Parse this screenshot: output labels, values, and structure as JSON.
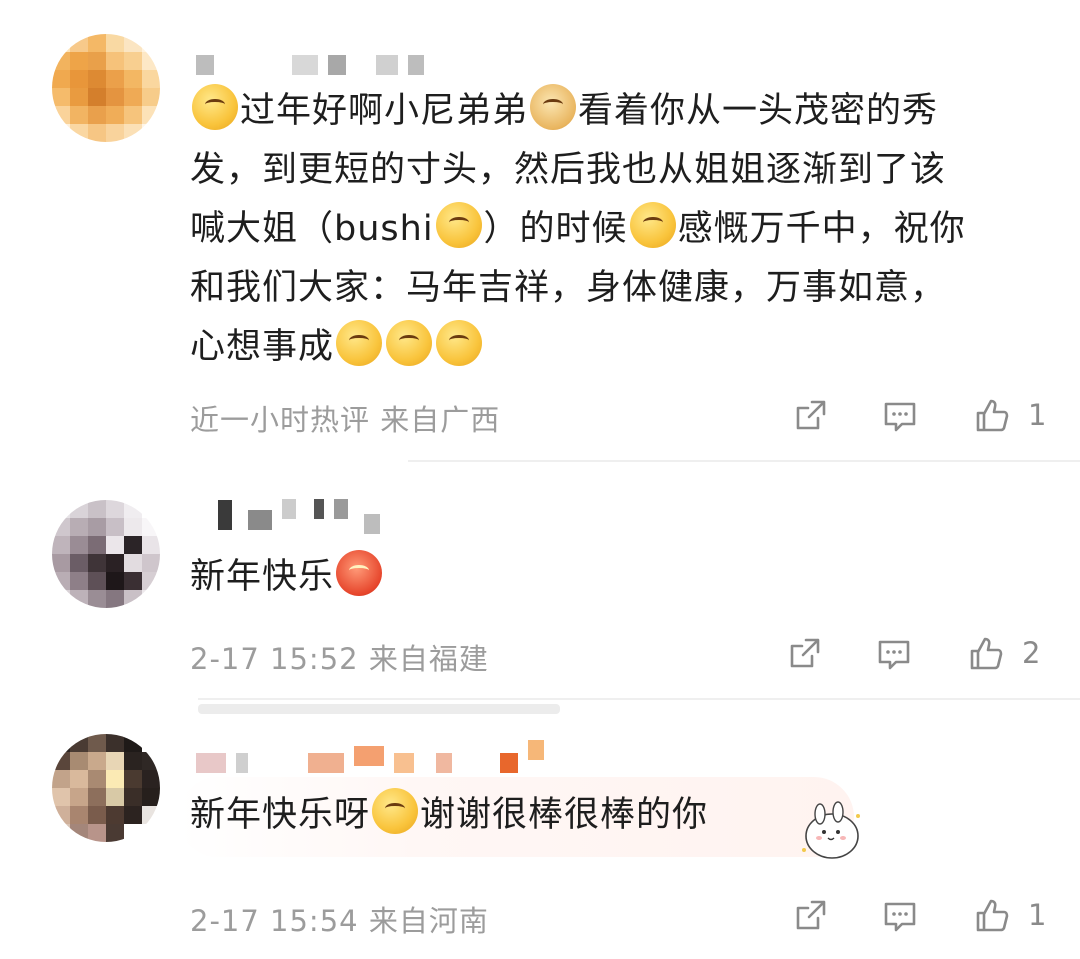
{
  "comments": [
    {
      "username_masked": true,
      "text_parts": [
        {
          "emoji": "smirk-666-emoji"
        },
        {
          "text": "过年好啊小尼弟弟"
        },
        {
          "emoji": "doge-emoji"
        },
        {
          "text": "看着你从一头茂密的秀发，到更短的寸头，然后我也从姐姐逐渐到了该喊大姐（bushi"
        },
        {
          "emoji": "laugh-cry-emoji"
        },
        {
          "text": "）的时候"
        },
        {
          "emoji": "cover-face-emoji"
        },
        {
          "text": "感慨万千中，祝你和我们大家：马年吉祥，身体健康，万事如意，心想事成"
        },
        {
          "emoji": "cheer-emoji"
        },
        {
          "emoji": "cheer-emoji"
        },
        {
          "emoji": "cheer-emoji"
        }
      ],
      "line1": "过年好啊小尼弟弟",
      "line1b": "看着你从一头茂密的秀",
      "line2": "发，到更短的寸头，然后我也从姐姐逐渐到了该",
      "line3a": "喊大姐（bushi",
      "line3b": "）的时候",
      "line3c": "感慨万千中，祝你",
      "line4": "和我们大家：马年吉祥，身体健康，万事如意，",
      "line5": "心想事成",
      "meta": "近一小时热评  来自广西",
      "likes": "1"
    },
    {
      "username_masked": true,
      "text": "新年快乐",
      "emoji": "fu-envelope-emoji",
      "meta": "2-17 15:52  来自福建",
      "likes": "2"
    },
    {
      "username_masked": true,
      "text_a": "新年快乐呀",
      "emoji": "kiss-emoji",
      "text_b": "谢谢很棒很棒的你",
      "meta": "2-17 15:54  来自河南",
      "likes": "1",
      "decoration": "bunny-sticker"
    }
  ],
  "icons": {
    "share": "share-icon",
    "comment": "comment-icon",
    "like": "thumbs-up-icon"
  },
  "colors": {
    "meta_text": "#9c9c9c",
    "body_text": "#1e1e1e",
    "divider": "#efefef"
  }
}
